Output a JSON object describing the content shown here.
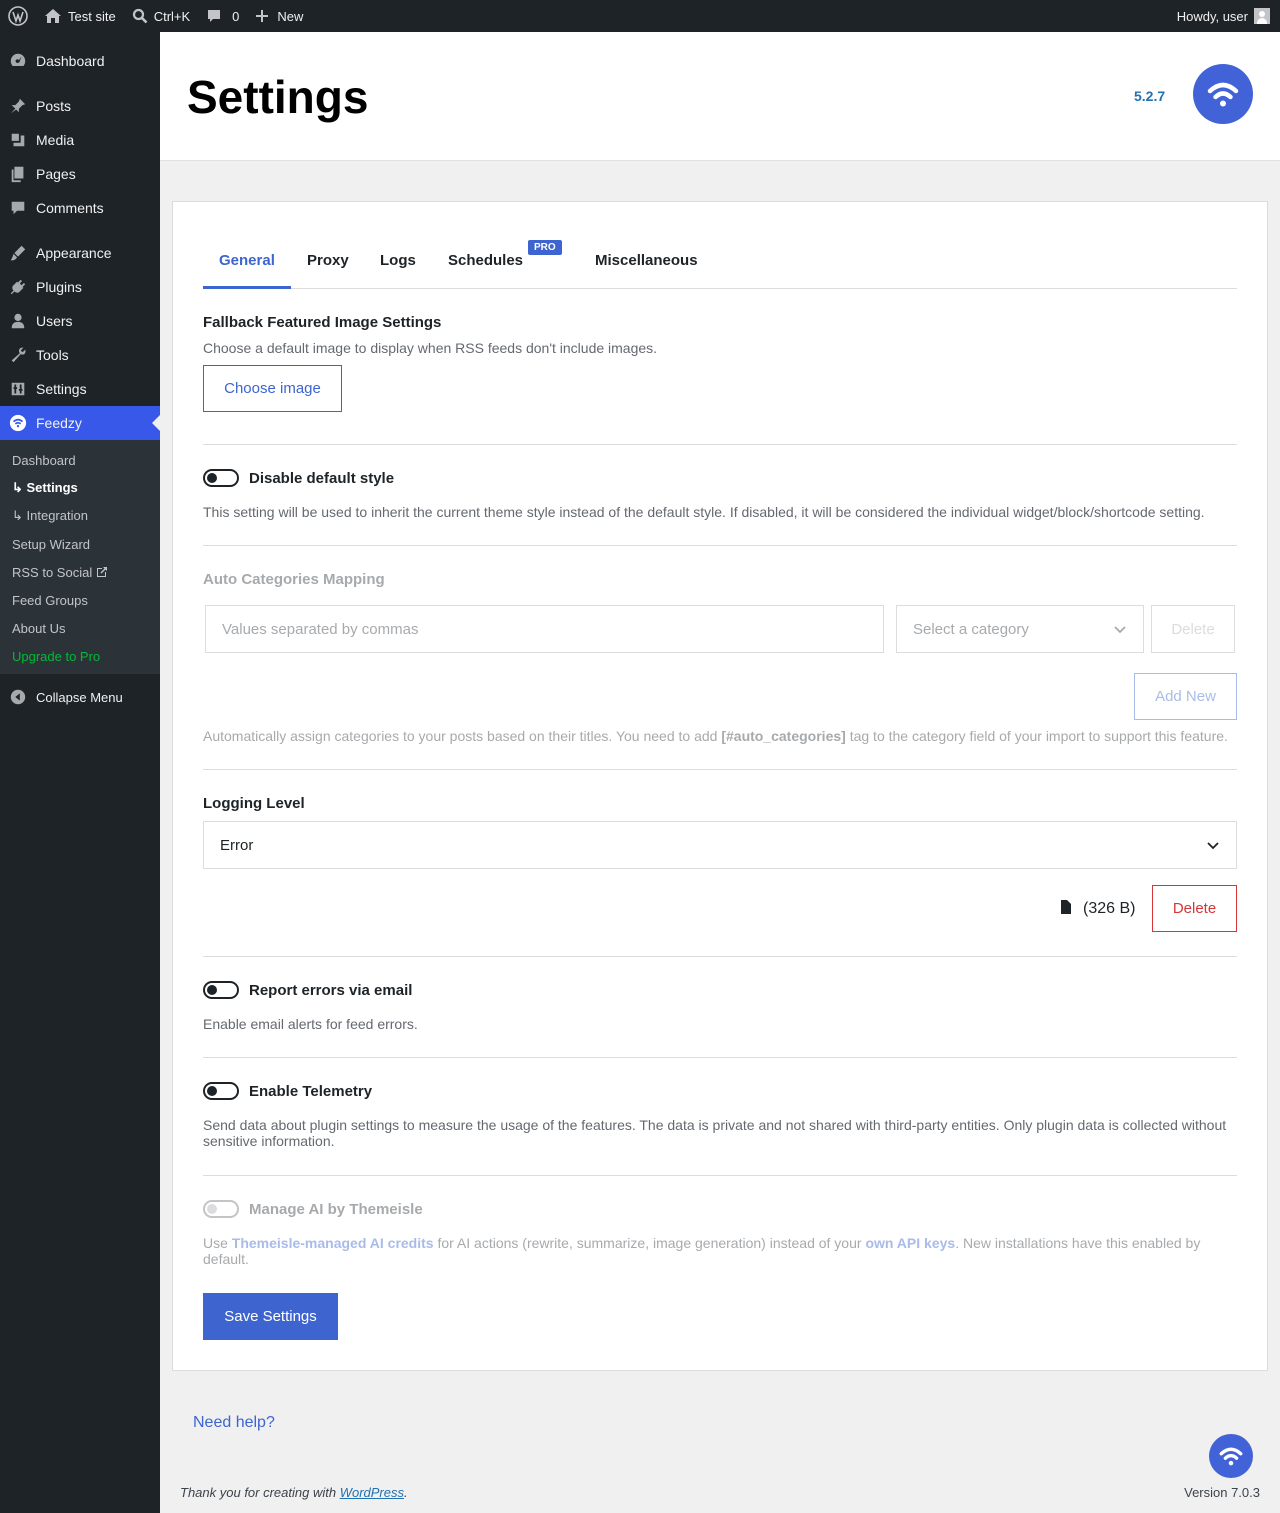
{
  "admin_bar": {
    "site_name": "Test site",
    "search_shortcut": "Ctrl+K",
    "comments_count": "0",
    "new_label": "New",
    "greeting": "Howdy, user"
  },
  "sidebar": {
    "items": [
      {
        "label": "Dashboard",
        "icon": "dashboard-icon"
      },
      {
        "label": "Posts",
        "icon": "pin-icon"
      },
      {
        "label": "Media",
        "icon": "media-icon"
      },
      {
        "label": "Pages",
        "icon": "pages-icon"
      },
      {
        "label": "Comments",
        "icon": "comment-icon"
      },
      {
        "label": "Appearance",
        "icon": "brush-icon"
      },
      {
        "label": "Plugins",
        "icon": "plug-icon"
      },
      {
        "label": "Users",
        "icon": "user-icon"
      },
      {
        "label": "Tools",
        "icon": "wrench-icon"
      },
      {
        "label": "Settings",
        "icon": "sliders-icon"
      },
      {
        "label": "Feedzy",
        "icon": "feedzy-icon"
      }
    ],
    "submenu": [
      "Dashboard",
      "↳ Settings",
      "↳ Integration",
      "Setup Wizard",
      "RSS to Social",
      "Feed Groups",
      "About Us",
      "Upgrade to Pro"
    ],
    "collapse_label": "Collapse Menu"
  },
  "header": {
    "title": "Settings",
    "version": "5.2.7"
  },
  "tabs": [
    "General",
    "Proxy",
    "Logs",
    "Schedules",
    "Miscellaneous"
  ],
  "pro_badge": "PRO",
  "fallback": {
    "title": "Fallback Featured Image Settings",
    "description": "Choose a default image to display when RSS feeds don't include images.",
    "button": "Choose image"
  },
  "disable_style": {
    "label": "Disable default style",
    "description": "This setting will be used to inherit the current theme style instead of the default style. If disabled, it will be considered the individual widget/block/shortcode setting.",
    "enabled": false
  },
  "auto_categories": {
    "title": "Auto Categories Mapping",
    "values_placeholder": "Values separated by commas",
    "category_placeholder": "Select a category",
    "delete_label": "Delete",
    "add_new_label": "Add New",
    "description_before": "Automatically assign categories to your posts based on their titles. You need to add ",
    "tag": "[#auto_categories]",
    "description_after": " tag to the category field of your import to support this feature."
  },
  "logging": {
    "title": "Logging Level",
    "selected": "Error",
    "file_size": "(326 B)",
    "delete_label": "Delete"
  },
  "report_errors": {
    "label": "Report errors via email",
    "description": "Enable email alerts for feed errors.",
    "enabled": false
  },
  "telemetry": {
    "label": "Enable Telemetry",
    "description": "Send data about plugin settings to measure the usage of the features. The data is private and not shared with third-party entities. Only plugin data is collected without sensitive information.",
    "enabled": false
  },
  "manage_ai": {
    "label": "Manage AI by Themeisle",
    "desc_1": "Use ",
    "link_1": "Themeisle-managed AI credits",
    "desc_2": " for AI actions (rewrite, summarize, image generation) instead of your ",
    "link_2": "own API keys",
    "desc_3": ". New installations have this enabled by default.",
    "enabled": false
  },
  "save_button": "Save Settings",
  "footer": {
    "help": "Need help?",
    "thanks_before": "Thank you for creating with ",
    "thanks_link": "WordPress",
    "thanks_after": ".",
    "version": "Version 7.0.3"
  },
  "colors": {
    "accent": "#3e65cf",
    "sidebar_bg": "#1d2327",
    "danger": "#d63638",
    "upgrade": "#00ba37"
  }
}
